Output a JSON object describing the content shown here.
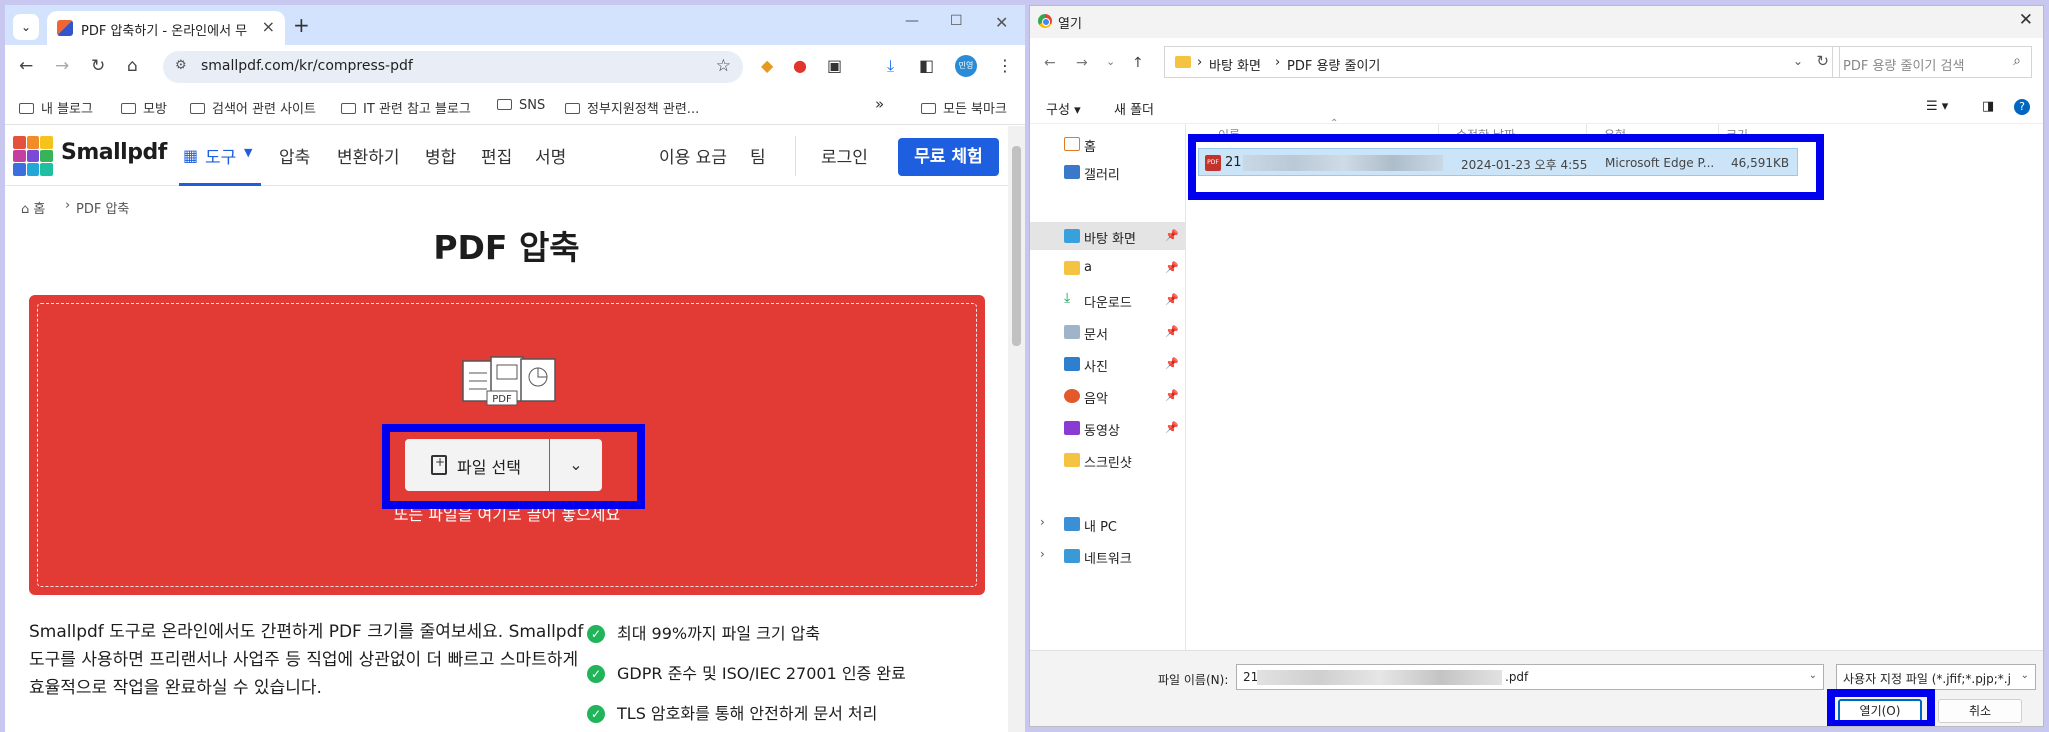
{
  "browser": {
    "tab_title": "PDF 압축하기 - 온라인에서 무",
    "url": "smallpdf.com/kr/compress-pdf",
    "profile_badge": "민영",
    "bookmarks": [
      "내 블로그",
      "모방",
      "검색어 관련 사이트",
      "IT 관련 참고 블로그",
      "SNS",
      "정부지원정책 관련..."
    ],
    "bookmarks_more": "»",
    "all_bookmarks": "모든 북마크"
  },
  "smallpdf": {
    "logo": "Smallpdf",
    "nav": {
      "tools": "도구",
      "compress": "압축",
      "convert": "변환하기",
      "merge": "병합",
      "edit": "편집",
      "sign": "서명",
      "pricing": "이용 요금",
      "team": "팀",
      "login": "로그인",
      "trial": "무료 체험"
    },
    "breadcrumb": {
      "home": "홈",
      "current": "PDF 압축"
    },
    "title": "PDF 압축",
    "choose_file": "파일 선택",
    "drop_hint": "또는 파일을 여기로 끌어 놓으세요",
    "pdf_badge": "PDF",
    "description": "Smallpdf 도구로 온라인에서도 간편하게 PDF 크기를 줄여보세요. Smallpdf 도구를 사용하면 프리랜서나 사업주 등 직업에 상관없이 더 빠르고 스마트하게 효율적으로 작업을 완료하실 수 있습니다.",
    "features": [
      "최대 99%까지 파일 크기 압축",
      "GDPR 준수 및 ISO/IEC 27001 인증 완료",
      "TLS 암호화를 통해 안전하게 문서 처리"
    ]
  },
  "dialog": {
    "title": "열기",
    "path": [
      "바탕 화면",
      "PDF 용량 줄이기"
    ],
    "search_placeholder": "PDF 용량 줄이기 검색",
    "organize": "구성",
    "new_folder": "새 폴더",
    "columns": {
      "name": "이름",
      "modified": "수정한 날짜",
      "type": "유형",
      "size": "크기"
    },
    "sidebar": {
      "home": "홈",
      "gallery": "갤러리",
      "desktop": "바탕 화면",
      "a": "a",
      "downloads": "다운로드",
      "documents": "문서",
      "pictures": "사진",
      "music": "음악",
      "videos": "동영상",
      "screenshots": "스크린샷",
      "this_pc": "내 PC",
      "network": "네트워크"
    },
    "file": {
      "name_prefix": "21",
      "modified": "2024-01-23 오후 4:55",
      "type": "Microsoft Edge P...",
      "size": "46,591KB"
    },
    "filename_label": "파일 이름(N):",
    "filename_prefix": "21",
    "filename_ext": ".pdf",
    "filetype": "사용자 지정 파일 (*.jfif;*.pjp;*.j",
    "open": "열기(O)",
    "cancel": "취소"
  },
  "colors": {
    "brand_blue": "#1e5fdf",
    "drop_red": "#e23a35",
    "highlight": "#0000ee",
    "check_green": "#21b45a"
  }
}
